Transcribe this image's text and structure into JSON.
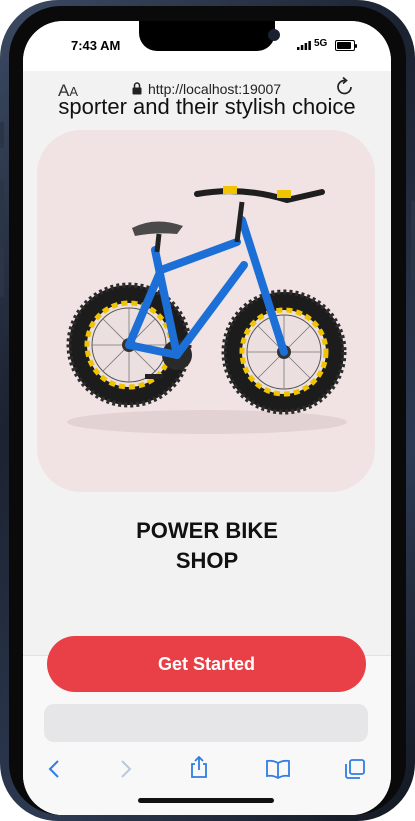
{
  "status_bar": {
    "time": "7:43 AM",
    "network": "5G"
  },
  "page": {
    "tagline": "sporter and their stylish choice",
    "shop_title_line1": "POWER BIKE",
    "shop_title_line2": "SHOP",
    "cta_label": "Get Started"
  },
  "browser": {
    "font_size_button": "AA",
    "url": "http://localhost:19007"
  },
  "colors": {
    "accent": "#e84046",
    "card_bg": "#f1e2e3",
    "page_bg": "#f2f2f2",
    "ios_blue": "#2f7de1"
  },
  "icons": {
    "signal": "signal-bars-icon",
    "battery": "battery-icon",
    "lock": "lock-icon",
    "reload": "reload-icon",
    "back": "chevron-left-icon",
    "forward": "chevron-right-icon",
    "share": "share-icon",
    "bookmarks": "book-icon",
    "tabs": "tabs-icon"
  }
}
